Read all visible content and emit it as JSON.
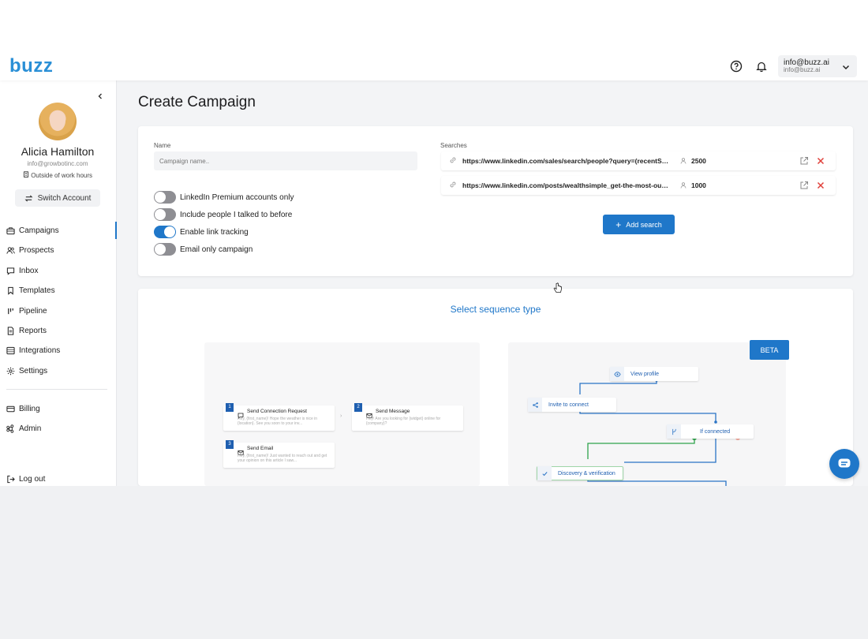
{
  "header": {
    "logo_text": "buzz",
    "account_email": "info@buzz.ai",
    "account_sub": "info@buzz.ai"
  },
  "sidebar": {
    "user_name": "Alicia Hamilton",
    "user_email": "info@growbotinc.com",
    "user_status": "Outside of work hours",
    "switch_account": "Switch Account",
    "items": [
      {
        "label": "Campaigns",
        "icon": "briefcase-icon",
        "active": true
      },
      {
        "label": "Prospects",
        "icon": "users-icon"
      },
      {
        "label": "Inbox",
        "icon": "inbox-icon"
      },
      {
        "label": "Templates",
        "icon": "bookmark-icon"
      },
      {
        "label": "Pipeline",
        "icon": "pipeline-icon"
      },
      {
        "label": "Reports",
        "icon": "report-icon"
      },
      {
        "label": "Integrations",
        "icon": "integrations-icon"
      },
      {
        "label": "Settings",
        "icon": "gear-icon"
      }
    ],
    "bottom_items": [
      {
        "label": "Billing",
        "icon": "card-icon"
      },
      {
        "label": "Admin",
        "icon": "admin-icon"
      }
    ],
    "logout": "Log out"
  },
  "page": {
    "title": "Create Campaign"
  },
  "campaign_form": {
    "name_label": "Name",
    "name_placeholder": "Campaign name..",
    "toggles": [
      {
        "label": "LinkedIn Premium accounts only",
        "on": false
      },
      {
        "label": "Include people I talked to before",
        "on": false
      },
      {
        "label": "Enable link tracking",
        "on": true
      },
      {
        "label": "Email only campaign",
        "on": false
      }
    ],
    "searches_label": "Searches",
    "searches": [
      {
        "url": "https://www.linkedin.com/sales/search/people?query=(recentSearchParam",
        "count": "2500"
      },
      {
        "url": "https://www.linkedin.com/posts/wealthsimple_get-the-most-out-of-your",
        "count": "1000"
      }
    ],
    "add_search": "Add search"
  },
  "sequence": {
    "title": "Select sequence type",
    "beta": "BETA",
    "linear_steps": [
      {
        "num": "1",
        "title": "Send Connection Request",
        "sub": "Hey, {first_name}! Hope the weather is nice in {location}. See you soon to your inv..."
      },
      {
        "num": "2",
        "title": "Send Message",
        "sub": "Hey! Are you looking for {widget} online for {company}?"
      },
      {
        "num": "3",
        "title": "Send Email",
        "sub": "Hey, {first_name}! Just wanted to reach out and get your opinion on this article I saw..."
      }
    ],
    "flow_nodes": [
      {
        "label": "View profile",
        "icon": "eye-icon"
      },
      {
        "label": "Invite to connect",
        "icon": "share-icon"
      },
      {
        "label": "If connected",
        "icon": "branch-icon"
      },
      {
        "label": "Discovery & verification",
        "icon": "check-icon"
      }
    ]
  },
  "colors": {
    "accent": "#1f77c9",
    "danger": "#e0403a"
  }
}
